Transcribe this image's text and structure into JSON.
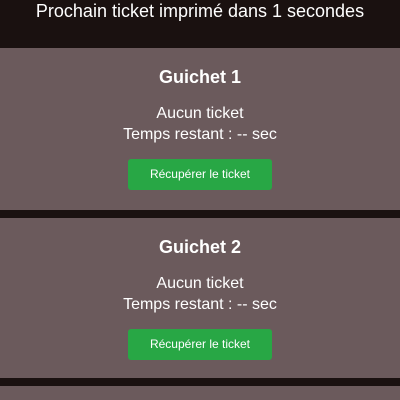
{
  "header": {
    "text": "Prochain ticket imprimé dans 1 secondes"
  },
  "counters": [
    {
      "title": "Guichet 1",
      "status": "Aucun ticket",
      "time": "Temps restant : -- sec",
      "button_label": "Récupérer le ticket"
    },
    {
      "title": "Guichet 2",
      "status": "Aucun ticket",
      "time": "Temps restant : -- sec",
      "button_label": "Récupérer le ticket"
    }
  ],
  "colors": {
    "background": "#1a1110",
    "panel": "#6b5a5c",
    "button": "#28a745"
  }
}
